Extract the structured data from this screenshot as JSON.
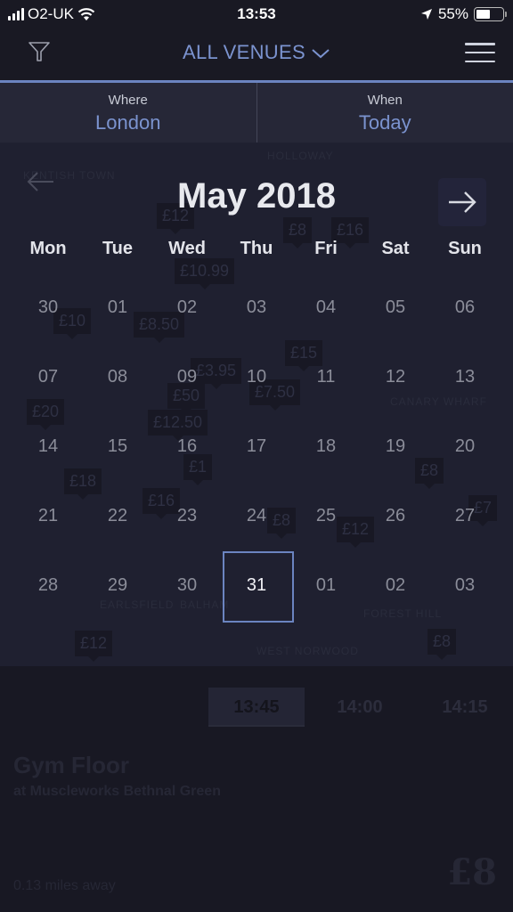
{
  "status_bar": {
    "carrier": "O2-UK",
    "time": "13:53",
    "battery_percent": "55%",
    "battery_level": 0.55,
    "icons": [
      "signal-icon",
      "wifi-icon",
      "location-arrow-icon",
      "battery-icon"
    ]
  },
  "header": {
    "filter_icon": "filter-icon",
    "title": "ALL VENUES",
    "title_icon": "chevron-down-icon",
    "menu_icon": "hamburger-menu-icon",
    "accent_color": "#7b93cf"
  },
  "selectors": {
    "where": {
      "label": "Where",
      "value": "London"
    },
    "when": {
      "label": "When",
      "value": "Today"
    }
  },
  "calendar": {
    "month_title": "May 2018",
    "prev_icon": "arrow-left-icon",
    "next_icon": "arrow-right-icon",
    "weekdays": [
      "Mon",
      "Tue",
      "Wed",
      "Thu",
      "Fri",
      "Sat",
      "Sun"
    ],
    "weeks": [
      [
        "30",
        "01",
        "02",
        "03",
        "04",
        "05",
        "06"
      ],
      [
        "07",
        "08",
        "09",
        "10",
        "11",
        "12",
        "13"
      ],
      [
        "14",
        "15",
        "16",
        "17",
        "18",
        "19",
        "20"
      ],
      [
        "21",
        "22",
        "23",
        "24",
        "25",
        "26",
        "27"
      ],
      [
        "28",
        "29",
        "30",
        "31",
        "01",
        "02",
        "03"
      ]
    ],
    "selected_day": "31",
    "selection_color": "#6b84c0"
  },
  "map": {
    "labels": [
      "HOLLOWAY",
      "KENTISH TOWN",
      "CANARY WHARF",
      "EARLSFIELD",
      "BALHAM",
      "FOREST HILL",
      "WEST NORWOOD"
    ],
    "pins": [
      "£12",
      "£8",
      "£16",
      "£10.99",
      "£10",
      "£8.50",
      "£3.95",
      "£15",
      "£50",
      "£7.50",
      "£20",
      "£12.50",
      "£18",
      "£16",
      "£1",
      "£8",
      "£12",
      "£8",
      "£7",
      "£12",
      "£8"
    ]
  },
  "card": {
    "times": [
      "13:45",
      "14:00",
      "14:15"
    ],
    "active_time": "13:45",
    "class_name": "Gym Floor",
    "venue": "at Muscleworks Bethnal Green",
    "distance": "0.13 miles away",
    "price": "£8"
  }
}
